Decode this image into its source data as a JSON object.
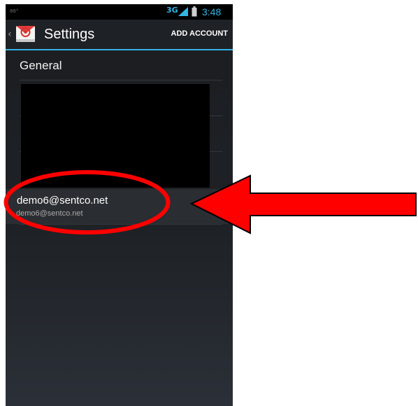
{
  "status_bar": {
    "left_text": "86°",
    "network": "3G",
    "time": "3:48"
  },
  "action_bar": {
    "up_glyph": "‹",
    "app_icon": "email-app-icon",
    "title": "Settings",
    "add_account_label": "ADD ACCOUNT"
  },
  "list": {
    "general_label": "General",
    "account": {
      "name": "demo6@sentco.net",
      "email": "demo6@sentco.net"
    }
  },
  "colors": {
    "accent": "#33b5e5",
    "annotation": "#ff0000",
    "background_dark": "#1e2125"
  }
}
